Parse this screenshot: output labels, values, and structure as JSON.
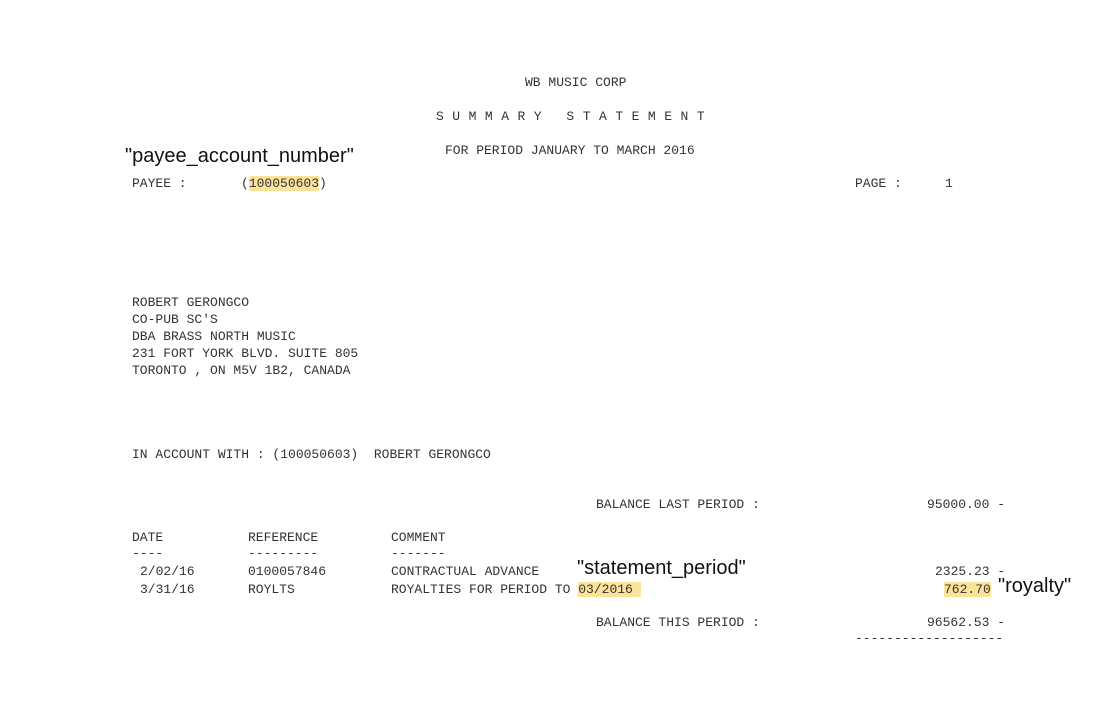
{
  "header": {
    "company": "WB MUSIC CORP",
    "title": "SUMMARY STATEMENT",
    "period": "FOR PERIOD JANUARY TO MARCH 2016"
  },
  "payee": {
    "label": "PAYEE :",
    "account_number": "100050603",
    "page_label": "PAGE :",
    "page_number": "1"
  },
  "address": [
    "ROBERT GERONGCO",
    "CO-PUB SC'S",
    "DBA BRASS NORTH MUSIC",
    "231 FORT YORK BLVD. SUITE 805",
    "TORONTO , ON M5V 1B2, CANADA"
  ],
  "account_line": "IN ACCOUNT WITH : (100050603)  ROBERT GERONGCO",
  "balance_last": {
    "label": "BALANCE LAST PERIOD :",
    "value": "95000.00 -"
  },
  "table": {
    "headers": [
      "DATE",
      "REFERENCE",
      "COMMENT"
    ],
    "underlines": [
      "----",
      "---------",
      "-------"
    ],
    "rows": [
      {
        "date": "2/02/16",
        "reference": "0100057846",
        "comment": "CONTRACTUAL ADVANCE",
        "amount": "2325.23 -"
      },
      {
        "date": "3/31/16",
        "reference": "ROYLTS",
        "comment": "ROYALTIES FOR PERIOD TO",
        "period": "03/2016",
        "amount": "762.70"
      }
    ]
  },
  "balance_this": {
    "label": "BALANCE THIS PERIOD :",
    "value": "96562.53 -",
    "rule": "-------------------"
  },
  "annotations": {
    "payee_account_number": "\"payee_account_number\"",
    "statement_period": "\"statement_period\"",
    "royalty": "\"royalty\""
  },
  "colors": {
    "highlight": "#fbe39a",
    "text": "#333333"
  }
}
